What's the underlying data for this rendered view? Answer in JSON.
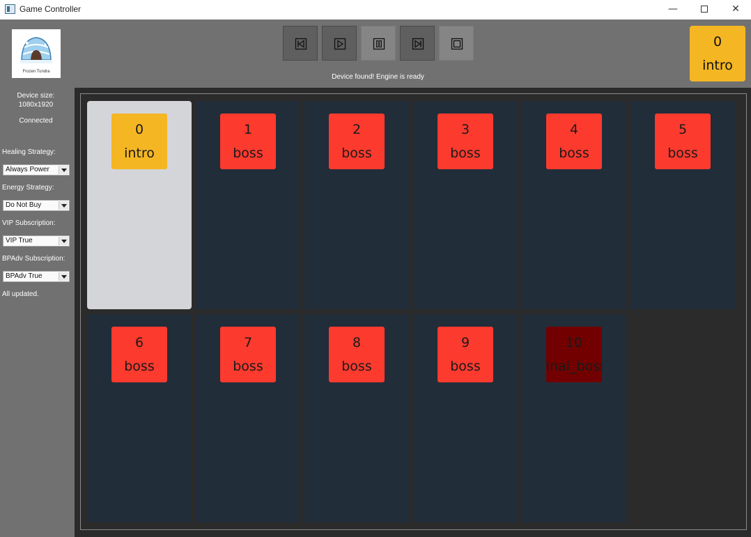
{
  "window": {
    "title": "Game Controller",
    "controls": {
      "minimize": "—",
      "close": "✕"
    }
  },
  "sidebar": {
    "logo_text": "Frozen Tundra",
    "device_size_label": "Device size:",
    "device_size_value": "1080x1920",
    "connection_status": "Connected",
    "healing_label": "Healing Strategy:",
    "healing_value": "Always Power",
    "energy_label": "Energy Strategy:",
    "energy_value": "Do Not Buy",
    "vip_label": "VIP Subscription:",
    "vip_value": "VIP True",
    "bpadv_label": "BPAdv Subscription:",
    "bpadv_value": "BPAdv True",
    "update_status": "All updated."
  },
  "toolbar": {
    "buttons": [
      "skip-back-icon",
      "play-icon",
      "pause-icon",
      "skip-forward-icon",
      "stop-icon"
    ],
    "status": "Device found! Engine is ready"
  },
  "current_stage": {
    "number": "0",
    "name": "intro"
  },
  "stages": [
    {
      "number": "0",
      "name": "intro",
      "kind": "intro",
      "selected": true
    },
    {
      "number": "1",
      "name": "boss",
      "kind": "boss"
    },
    {
      "number": "2",
      "name": "boss",
      "kind": "boss"
    },
    {
      "number": "3",
      "name": "boss",
      "kind": "boss"
    },
    {
      "number": "4",
      "name": "boss",
      "kind": "boss"
    },
    {
      "number": "5",
      "name": "boss",
      "kind": "boss"
    },
    {
      "number": "6",
      "name": "boss",
      "kind": "boss"
    },
    {
      "number": "7",
      "name": "boss",
      "kind": "boss"
    },
    {
      "number": "8",
      "name": "boss",
      "kind": "boss"
    },
    {
      "number": "9",
      "name": "boss",
      "kind": "boss"
    },
    {
      "number": "10",
      "name": "final_boss",
      "kind": "final"
    }
  ],
  "colors": {
    "intro": "#f5b623",
    "boss": "#fc3a2e",
    "final": "#730000",
    "cell": "#222d3a",
    "cell_selected": "#d4d5d9"
  }
}
